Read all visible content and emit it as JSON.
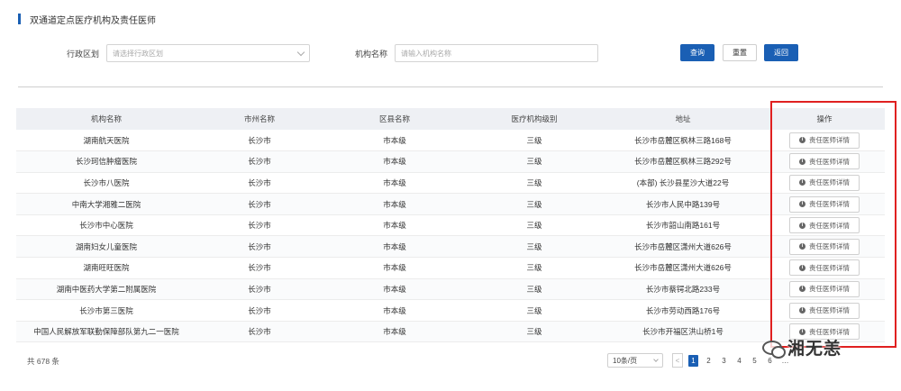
{
  "page": {
    "title": "双通道定点医疗机构及责任医师"
  },
  "filters": {
    "region_label": "行政区划",
    "region_placeholder": "请选择行政区划",
    "org_label": "机构名称",
    "org_placeholder": "请输入机构名称"
  },
  "buttons": {
    "query": "查询",
    "reset": "重置",
    "back": "返回"
  },
  "table": {
    "headers": [
      "机构名称",
      "市州名称",
      "区县名称",
      "医疗机构级别",
      "地址",
      "操作"
    ],
    "action_label": "责任医师详情",
    "rows": [
      [
        "湖南航天医院",
        "长沙市",
        "市本级",
        "三级",
        "长沙市岳麓区枫林三路168号"
      ],
      [
        "长沙珂信肿瘤医院",
        "长沙市",
        "市本级",
        "三级",
        "长沙市岳麓区枫林三路292号"
      ],
      [
        "长沙市八医院",
        "长沙市",
        "市本级",
        "三级",
        "(本部) 长沙县星沙大道22号"
      ],
      [
        "中南大学湘雅二医院",
        "长沙市",
        "市本级",
        "三级",
        "长沙市人民中路139号"
      ],
      [
        "长沙市中心医院",
        "长沙市",
        "市本级",
        "三级",
        "长沙市韶山南路161号"
      ],
      [
        "湖南妇女儿童医院",
        "长沙市",
        "市本级",
        "三级",
        "长沙市岳麓区潇州大道626号"
      ],
      [
        "湖南旺旺医院",
        "长沙市",
        "市本级",
        "三级",
        "长沙市岳麓区潇州大道626号"
      ],
      [
        "湖南中医药大学第二附属医院",
        "长沙市",
        "市本级",
        "三级",
        "长沙市蔡锷北路233号"
      ],
      [
        "长沙市第三医院",
        "长沙市",
        "市本级",
        "三级",
        "长沙市劳动西路176号"
      ],
      [
        "中国人民解放军联勤保障部队第九二一医院",
        "长沙市",
        "市本级",
        "三级",
        "长沙市开福区洪山桥1号"
      ]
    ]
  },
  "footer": {
    "total": "共 678 条",
    "page_size": "10条/页",
    "pages": [
      "1",
      "2",
      "3",
      "4",
      "5",
      "6"
    ],
    "current_page": "1",
    "ellipsis": "…"
  },
  "watermark": {
    "text": "湘无恙"
  },
  "colors": {
    "primary": "#1a5fb4",
    "highlight": "#e02020"
  }
}
